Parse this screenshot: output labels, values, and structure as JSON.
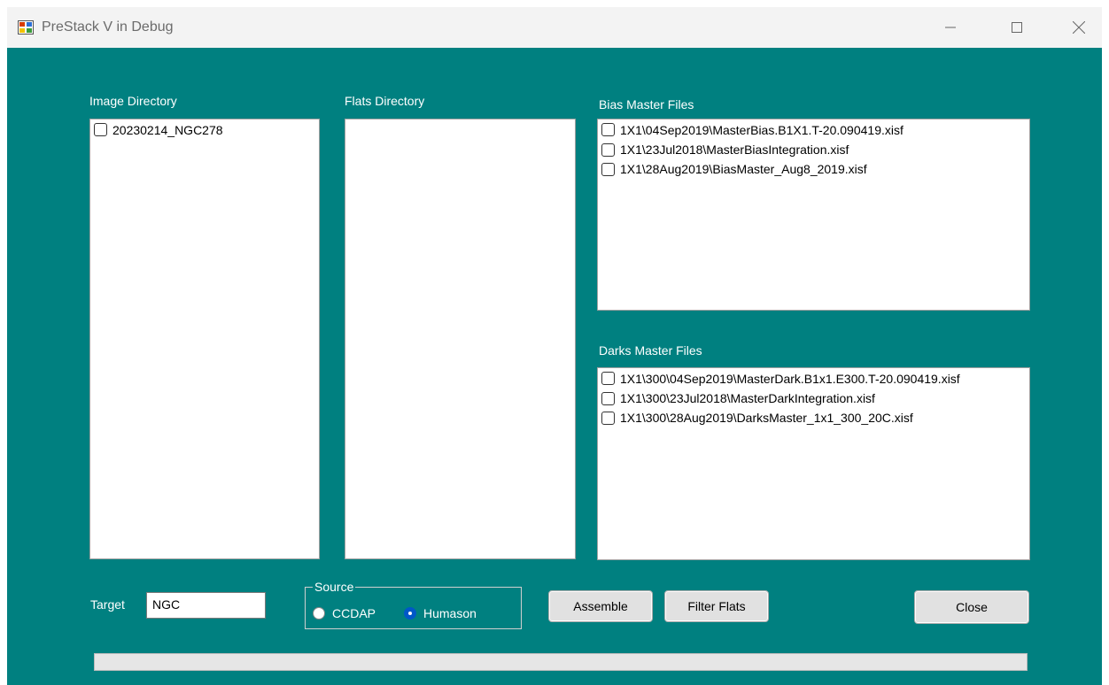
{
  "window": {
    "title": "PreStack V in Debug",
    "icon": "app-icon",
    "controls": {
      "minimize": "minimize-icon",
      "maximize": "maximize-icon",
      "close": "close-icon"
    }
  },
  "image_directory": {
    "label": "Image Directory",
    "items": [
      {
        "text": "20230214_NGC278",
        "checked": false
      }
    ]
  },
  "flats_directory": {
    "label": "Flats Directory",
    "items": []
  },
  "bias_master": {
    "label": "Bias Master Files",
    "items": [
      {
        "text": "1X1\\04Sep2019\\MasterBias.B1X1.T-20.090419.xisf",
        "checked": false
      },
      {
        "text": "1X1\\23Jul2018\\MasterBiasIntegration.xisf",
        "checked": false
      },
      {
        "text": "1X1\\28Aug2019\\BiasMaster_Aug8_2019.xisf",
        "checked": false
      }
    ]
  },
  "darks_master": {
    "label": "Darks Master Files",
    "items": [
      {
        "text": "1X1\\300\\04Sep2019\\MasterDark.B1x1.E300.T-20.090419.xisf",
        "checked": false
      },
      {
        "text": "1X1\\300\\23Jul2018\\MasterDarkIntegration.xisf",
        "checked": false
      },
      {
        "text": "1X1\\300\\28Aug2019\\DarksMaster_1x1_300_20C.xisf",
        "checked": false
      }
    ]
  },
  "target": {
    "label": "Target",
    "value": "NGC"
  },
  "source": {
    "label": "Source",
    "options": [
      {
        "label": "CCDAP",
        "selected": false
      },
      {
        "label": "Humason",
        "selected": true
      }
    ]
  },
  "buttons": {
    "assemble": "Assemble",
    "filter_flats": "Filter Flats",
    "close": "Close"
  },
  "progress": {
    "value": 0
  },
  "colors": {
    "background": "#008080",
    "radio_selected": "#0058c7"
  }
}
